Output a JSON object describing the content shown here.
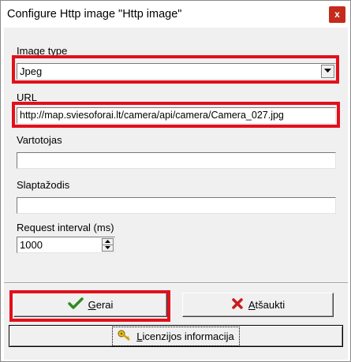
{
  "window": {
    "title": "Configure Http image \"Http image\"",
    "close_label": "x"
  },
  "form": {
    "image_type": {
      "label": "Image type",
      "value": "Jpeg"
    },
    "url": {
      "label": "URL",
      "value": "http://map.sviesoforai.lt/camera/api/camera/Camera_027.jpg"
    },
    "username": {
      "label": "Vartotojas",
      "value": ""
    },
    "password": {
      "label": "Slaptažodis",
      "value": ""
    },
    "interval": {
      "label": "Request interval (ms)",
      "value": "1000"
    }
  },
  "buttons": {
    "ok": {
      "first_letter": "G",
      "rest": "erai"
    },
    "cancel": {
      "first_letter": "A",
      "rest": "tšaukti"
    },
    "license": {
      "first_letter": "L",
      "rest": "icenzijos informacija"
    }
  },
  "highlight_color": "#e2101b",
  "icons": {
    "ok": "checkmark-icon",
    "cancel": "x-mark-icon",
    "license": "key-icon"
  }
}
